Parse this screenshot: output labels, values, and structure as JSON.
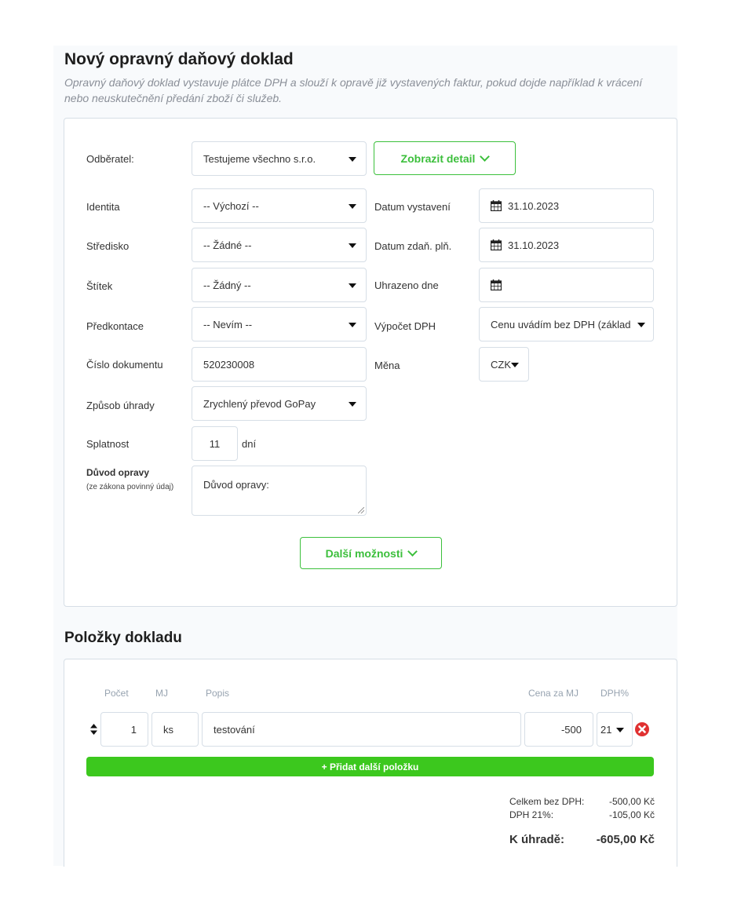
{
  "page": {
    "title": "Nový opravný daňový doklad",
    "subtitle": "Opravný daňový doklad vystavuje plátce DPH a slouží k opravě již vystavených faktur, pokud dojde například k vrácení nebo neuskutečnění předání zboží či služeb."
  },
  "form": {
    "odberatel_label": "Odběratel:",
    "odberatel_value": "Testujeme všechno s.r.o.",
    "detail_button": "Zobrazit detail",
    "identita_label": "Identita",
    "identita_value": "-- Výchozí --",
    "stredisko_label": "Středisko",
    "stredisko_value": "-- Žádné --",
    "stitek_label": "Štítek",
    "stitek_value": "-- Žádný --",
    "predkontace_label": "Předkontace",
    "predkontace_value": "-- Nevím --",
    "cislo_label": "Číslo dokumentu",
    "cislo_value": "520230008",
    "zpusob_label": "Způsob úhrady",
    "zpusob_value": "Zrychlený převod GoPay",
    "splatnost_label": "Splatnost",
    "splatnost_value": "11",
    "splatnost_unit": "dní",
    "duvod_label": "Důvod opravy",
    "duvod_hint": "(ze zákona povinný údaj)",
    "duvod_placeholder": "Důvod opravy:",
    "datum_vystaveni_label": "Datum vystavení",
    "datum_vystaveni_value": "31.10.2023",
    "datum_zdan_label": "Datum zdaň. plň.",
    "datum_zdan_value": "31.10.2023",
    "uhrazeno_label": "Uhrazeno dne",
    "uhrazeno_value": "",
    "vypocet_label": "Výpočet DPH",
    "vypocet_value": "Cenu uvádím bez DPH (základ",
    "mena_label": "Měna",
    "mena_value": "CZK",
    "more_button": "Další možnosti"
  },
  "items": {
    "heading": "Položky dokladu",
    "columns": {
      "pocet": "Počet",
      "mj": "MJ",
      "popis": "Popis",
      "cena": "Cena za MJ",
      "dph": "DPH%"
    },
    "rows": [
      {
        "pocet": "1",
        "mj": "ks",
        "popis": "testování",
        "cena": "-500",
        "dph": "21"
      }
    ],
    "add_button": "+ Přidat další položku"
  },
  "summary": {
    "bez_dph_label": "Celkem bez DPH:",
    "bez_dph_value": "-500,00 Kč",
    "dph_label": "DPH 21%:",
    "dph_value": "-105,00 Kč",
    "total_label": "K úhradě:",
    "total_value": "-605,00 Kč"
  },
  "colors": {
    "accent": "#3cc81e",
    "accent_outline": "#3cbf3c",
    "delete": "#e03131"
  },
  "icons": [
    "calendar-icon",
    "chevron-down-icon",
    "sort-icon",
    "delete-icon"
  ]
}
